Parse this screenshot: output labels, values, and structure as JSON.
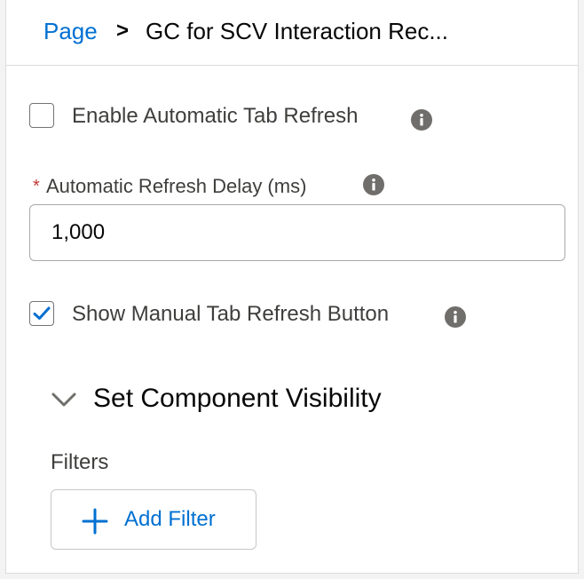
{
  "breadcrumb": {
    "parent": "Page",
    "separator": ">",
    "current": "GC for SCV Interaction Rec..."
  },
  "fields": {
    "auto_refresh": {
      "label": "Enable Automatic Tab Refresh",
      "checked": false
    },
    "refresh_delay": {
      "required_marker": "*",
      "label": "Automatic Refresh Delay (ms)",
      "value": "1,000"
    },
    "manual_refresh": {
      "label": "Show Manual Tab Refresh Button",
      "checked": true
    }
  },
  "visibility": {
    "title": "Set Component Visibility",
    "expanded": true,
    "filters_label": "Filters",
    "add_filter_label": "Add Filter"
  },
  "colors": {
    "link": "#0070d2",
    "required": "#c23934",
    "info_icon": "#706e6b"
  },
  "icons": {
    "info": "info-icon",
    "chevron": "chevron-down-icon",
    "add": "plus-icon",
    "check": "checkmark-icon"
  }
}
